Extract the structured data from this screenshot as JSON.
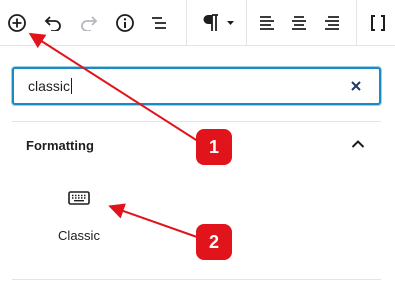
{
  "toolbar": {
    "items": [
      {
        "name": "add-block-icon"
      },
      {
        "name": "undo-icon"
      },
      {
        "name": "redo-icon"
      },
      {
        "name": "info-icon"
      },
      {
        "name": "list-view-icon"
      },
      {
        "name": "paragraph-icon"
      },
      {
        "name": "align-left-icon"
      },
      {
        "name": "align-center-icon"
      },
      {
        "name": "align-right-icon"
      },
      {
        "name": "brackets-icon"
      }
    ]
  },
  "search": {
    "value": "classic",
    "placeholder": "",
    "clear_icon": "close-icon"
  },
  "panel": {
    "title": "Formatting",
    "toggle_icon": "chevron-up-icon",
    "blocks": [
      {
        "label": "Classic",
        "icon": "keyboard-icon"
      }
    ]
  },
  "annotations": {
    "badge1": "1",
    "badge2": "2",
    "color": "#e2141b"
  },
  "colors": {
    "accent": "#1a8bc2",
    "text": "#1e1e1e",
    "disabled": "#b5b8bd"
  }
}
